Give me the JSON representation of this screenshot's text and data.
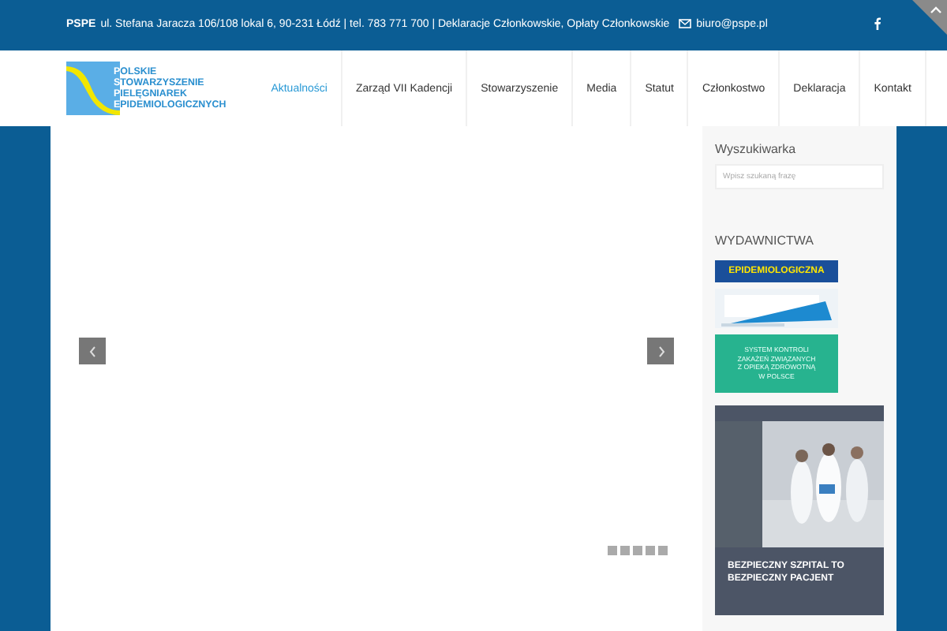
{
  "topbar": {
    "brand": "PSPE",
    "address": "ul. Stefana Jaracza 106/108 lokal 6, 90-231 Łódź | tel. 783 771 700 | Deklaracje Członkowskie, Opłaty Członkowskie",
    "email": "biuro@pspe.pl"
  },
  "logo": {
    "lines": [
      "OLSKIE",
      "TOWARZYSZENIE",
      "IELĘGNIAREK",
      "PIDEMIOLOGICZNYCH"
    ],
    "initials": [
      "P",
      "S",
      "P",
      "E"
    ]
  },
  "nav": [
    {
      "label": "Aktualności",
      "selected": true
    },
    {
      "label": "Zarząd VII Kadencji",
      "selected": false
    },
    {
      "label": "Stowarzyszenie",
      "selected": false
    },
    {
      "label": "Media",
      "selected": false
    },
    {
      "label": "Statut",
      "selected": false
    },
    {
      "label": "Członkostwo",
      "selected": false
    },
    {
      "label": "Deklaracja",
      "selected": false
    },
    {
      "label": "Kontakt",
      "selected": false
    }
  ],
  "slider": {
    "dots": [
      {
        "selected": false
      },
      {
        "selected": false
      },
      {
        "selected": false
      },
      {
        "selected": false
      },
      {
        "selected": false
      }
    ]
  },
  "sidebar": {
    "search_title": "Wyszukiwarka",
    "search": {
      "placeholder": "Wpisz szukaną frazę"
    },
    "publications_title": "WYDAWNICTWA",
    "publications": [
      {
        "kind": "banner",
        "title": "EPIDEMIOLOGICZNA"
      },
      {
        "kind": "picture"
      },
      {
        "kind": "teal",
        "title": "SYSTEM KONTROLI ZAKAŻEŃ ZWIĄZANYCH Z OPIEKĄ ZDROWOTNĄ W POLSCE"
      },
      {
        "title": "BEZPIECZNY SZPITAL TO BEZPIECZNY PACJENT"
      }
    ]
  }
}
